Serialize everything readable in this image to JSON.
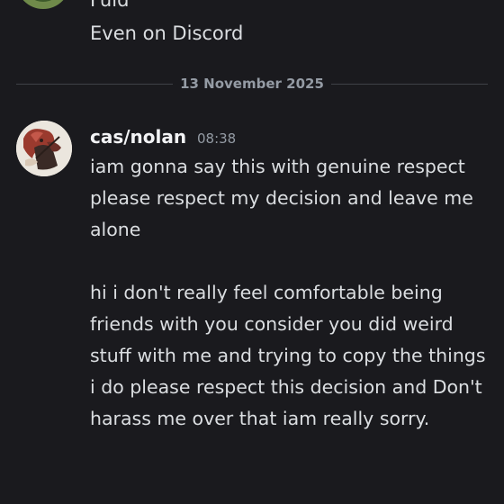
{
  "previous_message": {
    "partial_line": "Fuid",
    "line": "Even on Discord"
  },
  "date_divider": "13 November 2025",
  "message": {
    "username": "cas/nolan",
    "timestamp": "08:38",
    "paragraphs": [
      "iam gonna say this with genuine respect please respect my decision and leave me alone",
      "hi i don't really feel comfortable being friends with you consider you did weird stuff with me and trying to copy the things i do please respect this decision and Don't harass me over that iam really sorry."
    ]
  },
  "colors": {
    "background": "#1a1a1e",
    "text": "#dbdee1",
    "muted": "#949ba4",
    "username": "#f2f3f5"
  }
}
